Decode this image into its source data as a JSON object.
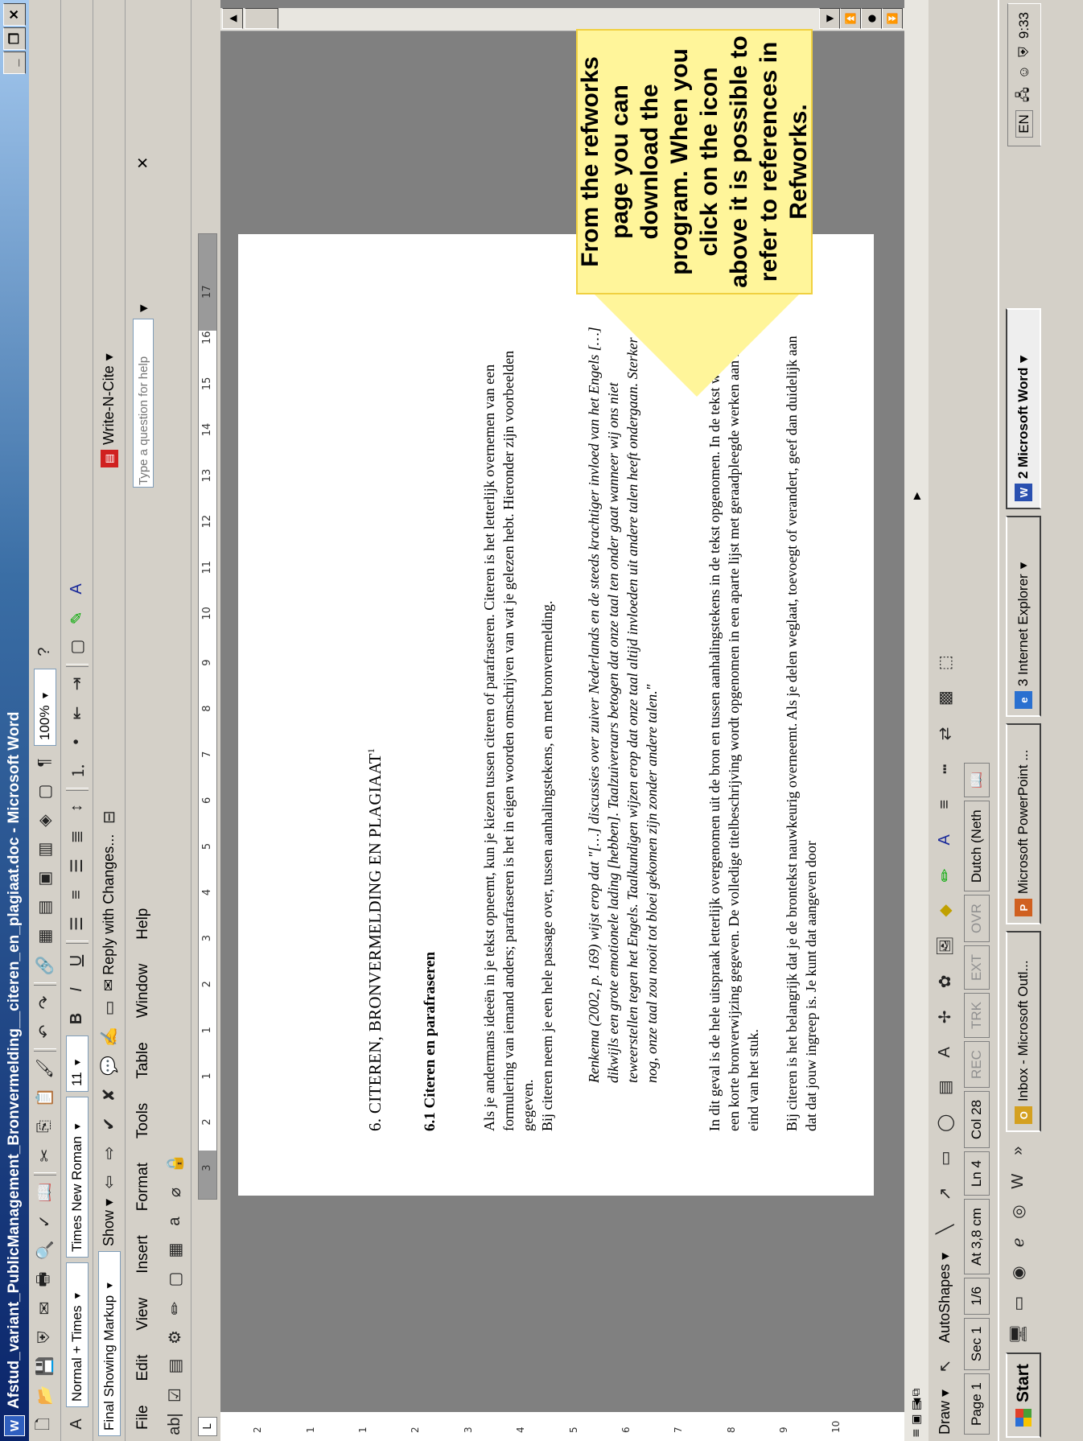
{
  "window": {
    "title": "Afstud_variant_PublicManagement_Bronvermelding__citeren_en_plagiaat.doc - Microsoft Word",
    "icon": "word-icon"
  },
  "toolbar_standard": {
    "zoom": "100%"
  },
  "toolbar_formatting": {
    "style": "Normal + Times",
    "font": "Times New Roman",
    "size": "11"
  },
  "toolbar_reviewing": {
    "markup": "Final Showing Markup",
    "show": "Show",
    "reply": "Reply with Changes..."
  },
  "writencite": {
    "label": "Write-N-Cite",
    "help_placeholder": "Type a question for help"
  },
  "menu": [
    "File",
    "Edit",
    "View",
    "Insert",
    "Format",
    "Tools",
    "Table",
    "Window",
    "Help"
  ],
  "document": {
    "heading1": "6. CITEREN, BRONVERMELDING EN PLAGIAAT",
    "heading1_sup": "1",
    "heading2": "6.1 Citeren en parafraseren",
    "para1": "Als je andermans ideeën in je tekst opneemt, kun je kiezen tussen citeren of parafraseren. Citeren is het letterlijk overnemen van een formulering van iemand anders; parafraseren is het in eigen woorden omschrijven van wat je gelezen hebt. Hieronder zijn voorbeelden gegeven.",
    "para2": "Bij citeren neem je een hele passage over, tussen aanhalingstekens, en met bronvermelding.",
    "quote": "Renkema (2002, p. 169) wijst erop dat \"[…] discussies over zuiver Nederlands en de steeds krachtiger invloed van het Engels […] dikwijls een grote emotionele lading [hebben]. Taalzuiveraars betogen dat onze taal ten onder gaat wanneer wij ons niet teweerstellen tegen het Engels. Taalkundigen wijzen erop dat onze taal altijd invloeden uit andere talen heeft ondergaan. Sterker nog, onze taal zou nooit tot bloei gekomen zijn zonder andere talen.\"",
    "para3": "In dit geval is de hele uitspraak letterlijk overgenomen uit de bron en tussen aanhalingstekens in de tekst opgenomen. In de tekst wordt een korte bronverwijzing gegeven. De volledige titelbeschrijving wordt opgenomen in een aparte lijst met geraadpleegde werken aan het eind van het stuk.",
    "para4": "Bij citeren is het belangrijk dat je de brontekst nauwkeurig overneemt. Als je delen weglaat, toevoegt of verandert, geef dan duidelijk aan dat dat jouw ingreep is. Je kunt dat aangeven door"
  },
  "ruler": [
    "3",
    "2",
    "1",
    "1",
    "2",
    "3",
    "4",
    "5",
    "6",
    "7",
    "8",
    "9",
    "10",
    "11",
    "12",
    "13",
    "14",
    "15",
    "16",
    "17"
  ],
  "vruler": [
    "2",
    "1",
    "1",
    "2",
    "3",
    "4",
    "5",
    "6",
    "7",
    "8",
    "9",
    "10"
  ],
  "drawbar": {
    "draw": "Draw",
    "autoshapes": "AutoShapes"
  },
  "status": {
    "page": "Page 1",
    "sec": "Sec 1",
    "pages": "1/6",
    "at": "At 3,8 cm",
    "ln": "Ln 4",
    "col": "Col 28",
    "rec": "REC",
    "trk": "TRK",
    "ext": "EXT",
    "ovr": "OVR",
    "lang": "Dutch (Neth"
  },
  "taskbar": {
    "start": "Start",
    "tasks": [
      {
        "label": "Inbox - Microsoft Outl...",
        "icon": "outlook-icon",
        "color": "#d4a020"
      },
      {
        "label": "Microsoft PowerPoint ...",
        "icon": "powerpoint-icon",
        "color": "#d06020"
      },
      {
        "label": "3 Internet Explorer",
        "icon": "ie-icon",
        "color": "#2a70d0"
      },
      {
        "label": "2 Microsoft Word",
        "icon": "word-icon",
        "color": "#2a50b0"
      }
    ],
    "lang": "EN",
    "time": "9:33"
  },
  "callout": {
    "text": "From the refworks page you can download the program. When you click on the icon above it is possible to refer to references in Refworks."
  }
}
